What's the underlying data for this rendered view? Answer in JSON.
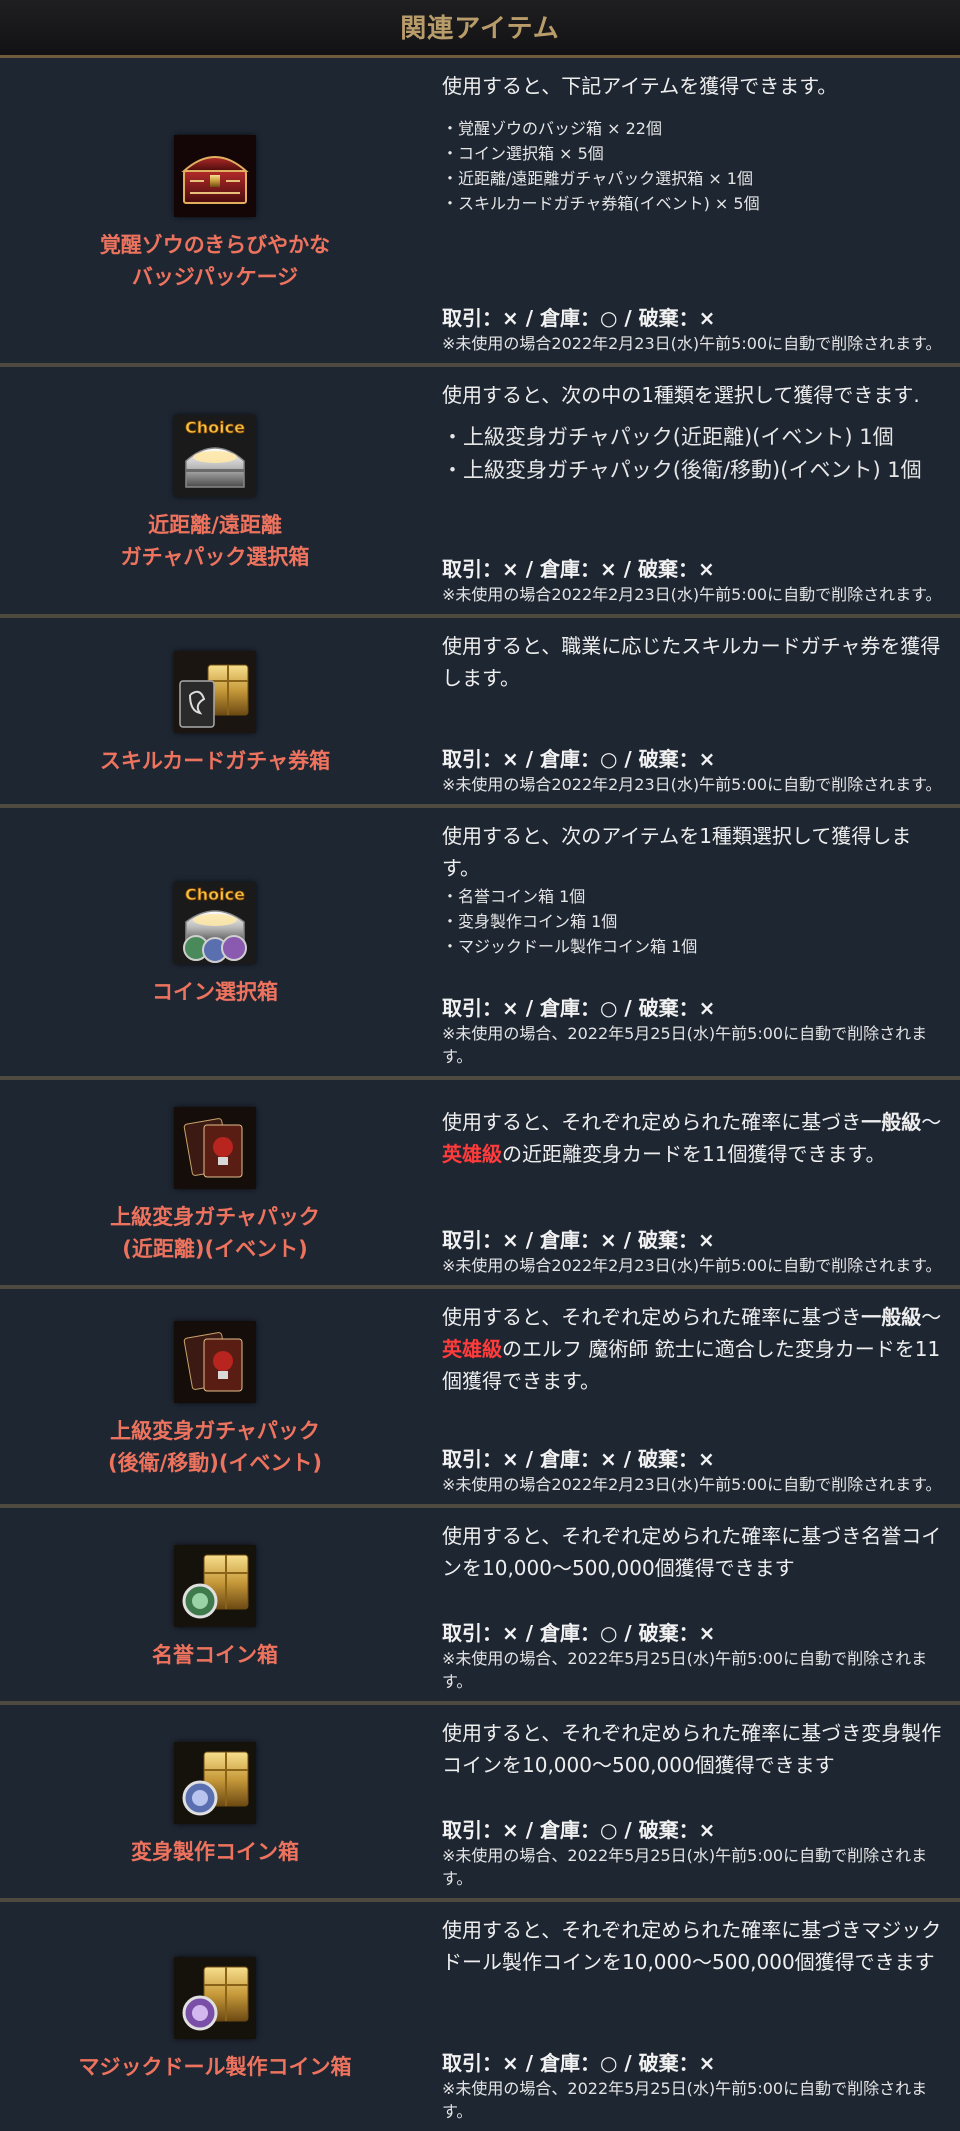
{
  "header": {
    "title": "関連アイテム"
  },
  "items": [
    {
      "name1": "覚醒ゾウのきらびやかな",
      "name2": "バッジパッケージ",
      "icon": "red-treasure-chest-icon",
      "desc": "使用すると、下記アイテムを獲得できます。",
      "list": [
        "・覚醒ゾウのバッジ箱 × 22個",
        "・コイン選択箱 × 5個",
        "・近距離/遠距離ガチャパック選択箱 × 1個",
        "・スキルカードガチャ券箱(イベント) × 5個"
      ],
      "trade": "取引：× / 倉庫：○ / 破棄：×",
      "note": "※未使用の場合2022年2月23日(水)午前5:00に自動で削除されます。"
    },
    {
      "name1": "近距離/遠距離",
      "name2": "ガチャパック選択箱",
      "icon": "choice-silver-chest-icon",
      "badge": "Choice",
      "desc": "使用すると、次の中の1種類を選択して獲得できます.",
      "list": [
        "・上級変身ガチャパック(近距離)(イベント) 1個",
        "・上級変身ガチャパック(後衛/移動)(イベント) 1個"
      ],
      "trade": "取引：× / 倉庫：× / 破棄：×",
      "note": "※未使用の場合2022年2月23日(水)午前5:00に自動で削除されます。"
    },
    {
      "name1": "スキルカードガチャ券箱",
      "icon": "skill-card-chest-icon",
      "desc": "使用すると、職業に応じたスキルカードガチャ券を獲得します。",
      "trade": "取引：× / 倉庫：○ / 破棄：×",
      "note": "※未使用の場合2022年2月23日(水)午前5:00に自動で削除されます。"
    },
    {
      "name1": "コイン選択箱",
      "icon": "choice-coin-chest-icon",
      "badge": "Choice",
      "desc": "使用すると、次のアイテムを1種類選択して獲得します。",
      "list": [
        "・名誉コイン箱 1個",
        "・変身製作コイン箱 1個",
        "・マジックドール製作コイン箱 1個"
      ],
      "trade": "取引：× / 倉庫：○ / 破棄：×",
      "note": "※未使用の場合、2022年5月25日(水)午前5:00に自動で削除されます。"
    },
    {
      "name1": "上級変身ガチャパック",
      "name2": "(近距離)(イベント)",
      "icon": "transform-card-pack-icon",
      "desc_a": "使用すると、それぞれ定められた確率に基づき",
      "desc_b": "一般級",
      "desc_c": "～",
      "desc_d": "英雄級",
      "desc_e": "の近距離変身カードを11個獲得できます。",
      "trade": "取引：× / 倉庫：× / 破棄：×",
      "note": "※未使用の場合2022年2月23日(水)午前5:00に自動で削除されます。"
    },
    {
      "name1": "上級変身ガチャパック",
      "name2": "(後衛/移動)(イベント)",
      "icon": "transform-card-pack-icon",
      "desc_a": "使用すると、それぞれ定められた確率に基づき",
      "desc_b": "一般級",
      "desc_c": "～",
      "desc_d": "英雄級",
      "desc_e": "のエルフ 魔術師 銃士に適合した変身カードを11個獲得できます。",
      "trade": "取引：× / 倉庫：× / 破棄：×",
      "note": "※未使用の場合2022年2月23日(水)午前5:00に自動で削除されます。"
    },
    {
      "name1": "名誉コイン箱",
      "icon": "honor-coin-chest-icon",
      "desc": "使用すると、それぞれ定められた確率に基づき名誉コインを10,000～500,000個獲得できます",
      "trade": "取引：× / 倉庫：○ / 破棄：×",
      "note": "※未使用の場合、2022年5月25日(水)午前5:00に自動で削除されます。"
    },
    {
      "name1": "変身製作コイン箱",
      "icon": "transform-coin-chest-icon",
      "desc": "使用すると、それぞれ定められた確率に基づき変身製作コインを10,000～500,000個獲得できます",
      "trade": "取引：× / 倉庫：○ / 破棄：×",
      "note": "※未使用の場合、2022年5月25日(水)午前5:00に自動で削除されます。"
    },
    {
      "name1": "マジックドール製作コイン箱",
      "icon": "magicdoll-coin-chest-icon",
      "desc": "使用すると、それぞれ定められた確率に基づきマジックドール製作コインを10,000～500,000個獲得できます",
      "trade": "取引：× / 倉庫：○ / 破棄：×",
      "note": "※未使用の場合、2022年5月25日(水)午前5:00に自動で削除されます。"
    }
  ]
}
